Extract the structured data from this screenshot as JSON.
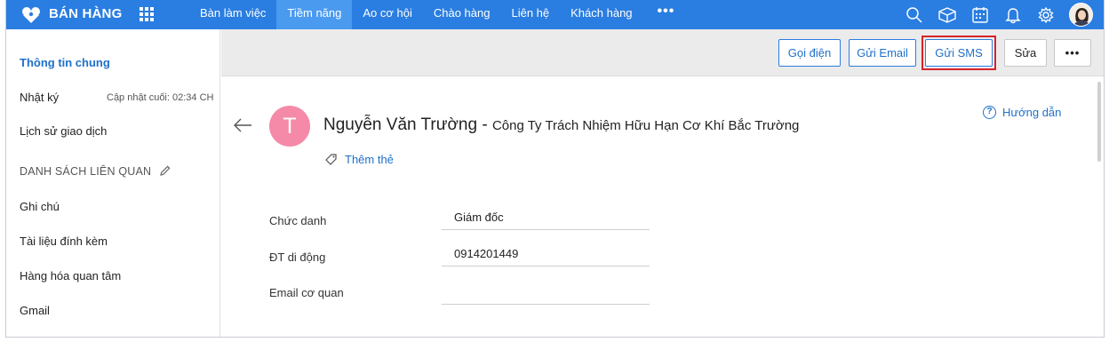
{
  "app": {
    "title": "BÁN HÀNG"
  },
  "nav": {
    "items": [
      {
        "label": "Bàn làm việc",
        "active": false
      },
      {
        "label": "Tiềm năng",
        "active": true
      },
      {
        "label": "Ao cơ hội",
        "active": false
      },
      {
        "label": "Chào hàng",
        "active": false
      },
      {
        "label": "Liên hệ",
        "active": false
      },
      {
        "label": "Khách hàng",
        "active": false
      }
    ],
    "more_label": "•••"
  },
  "top_icons": [
    "search-icon",
    "cube-icon",
    "calendar-icon",
    "bell-icon",
    "settings-icon"
  ],
  "sidebar": {
    "general_info": "Thông tin chung",
    "log": "Nhật ký",
    "last_update": "Cập nhật cuối: 02:34 CH",
    "transaction_history": "Lịch sử giao dịch",
    "related_list_heading": "DANH SÁCH LIÊN QUAN",
    "related_items": [
      "Ghi chú",
      "Tài liệu đính kèm",
      "Hàng hóa quan tâm",
      "Gmail"
    ]
  },
  "actions": {
    "call": "Gọi điện",
    "email": "Gửi Email",
    "sms": "Gửi SMS",
    "edit": "Sửa",
    "more": "•••"
  },
  "contact": {
    "initial": "T",
    "name": "Nguyễn Văn Trường",
    "separator": " - ",
    "company": "Công Ty Trách Nhiệm Hữu Hạn Cơ Khí Bắc Trường",
    "add_tag": "Thêm thẻ",
    "avatar_color": "#f48aa8"
  },
  "help": {
    "label": "Hướng dẫn"
  },
  "fields": [
    {
      "label": "Chức danh",
      "value": "Giám đốc"
    },
    {
      "label": "ĐT di động",
      "value": "0914201449"
    },
    {
      "label": "Email cơ quan",
      "value": ""
    }
  ],
  "colors": {
    "accent": "#2a7de1",
    "link": "#1f70c9",
    "highlight": "#d8242b"
  }
}
